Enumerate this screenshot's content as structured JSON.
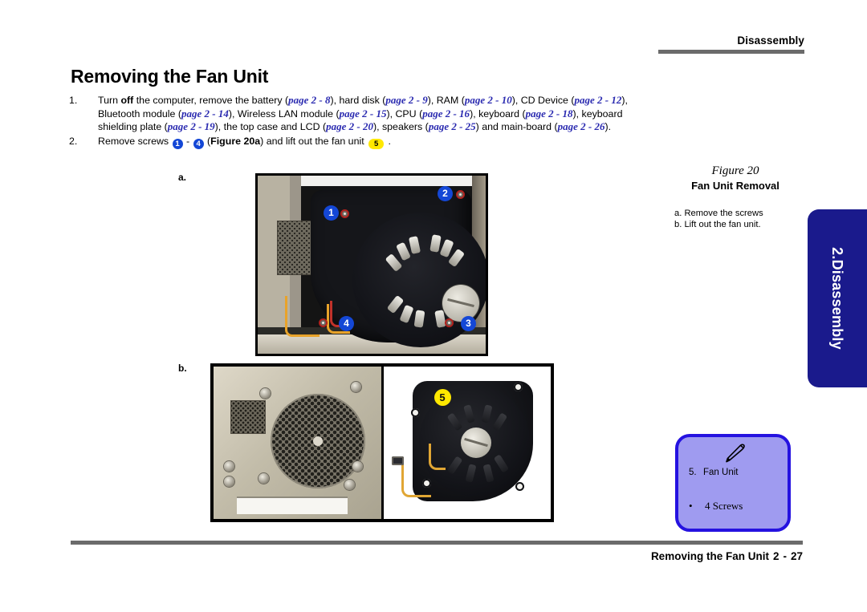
{
  "header": {
    "section": "Disassembly"
  },
  "title": "Removing the Fan Unit",
  "steps": [
    {
      "number": "1.",
      "segments": [
        {
          "t": "Turn ",
          "s": "plain"
        },
        {
          "t": "off",
          "s": "bold"
        },
        {
          "t": " the computer, remove the battery (",
          "s": "plain"
        },
        {
          "t": "page 2 - 8",
          "s": "ref"
        },
        {
          "t": "), hard disk (",
          "s": "plain"
        },
        {
          "t": "page 2 - 9",
          "s": "ref"
        },
        {
          "t": "),  RAM (",
          "s": "plain"
        },
        {
          "t": "page 2 - 10",
          "s": "ref"
        },
        {
          "t": "), CD Device (",
          "s": "plain"
        },
        {
          "t": "page 2 - 12",
          "s": "ref"
        },
        {
          "t": "), Bluetooth module (",
          "s": "plain"
        },
        {
          "t": "page 2 - 14",
          "s": "ref"
        },
        {
          "t": "), Wireless LAN module (",
          "s": "plain"
        },
        {
          "t": "page 2 - 15",
          "s": "ref"
        },
        {
          "t": "), CPU (",
          "s": "plain"
        },
        {
          "t": "page 2 - 16",
          "s": "ref"
        },
        {
          "t": "), keyboard (",
          "s": "plain"
        },
        {
          "t": "page 2 - 18",
          "s": "ref"
        },
        {
          "t": "), keyboard shielding plate (",
          "s": "plain"
        },
        {
          "t": "page 2 - 19",
          "s": "ref"
        },
        {
          "t": "),  the top case and LCD (",
          "s": "plain"
        },
        {
          "t": "page 2 - 20",
          "s": "ref"
        },
        {
          "t": "), speakers (",
          "s": "plain"
        },
        {
          "t": "page 2 - 25",
          "s": "ref"
        },
        {
          "t": ") and main-board (",
          "s": "plain"
        },
        {
          "t": "page 2 - 26",
          "s": "ref"
        },
        {
          "t": ").",
          "s": "plain"
        }
      ]
    },
    {
      "number": "2.",
      "segments": [
        {
          "t": "Remove screws ",
          "s": "plain"
        },
        {
          "t": "1",
          "s": "badge"
        },
        {
          "t": " - ",
          "s": "plain"
        },
        {
          "t": "4",
          "s": "badge"
        },
        {
          "t": " (",
          "s": "plain"
        },
        {
          "t": "Figure 20a",
          "s": "bold"
        },
        {
          "t": ") and lift out the fan unit ",
          "s": "plain"
        },
        {
          "t": "5",
          "s": "badge-yellow"
        },
        {
          "t": " .",
          "s": "plain"
        }
      ]
    }
  ],
  "figures": {
    "label_a": "a.",
    "label_b": "b.",
    "figure_a_callouts": [
      "1",
      "2",
      "3",
      "4"
    ],
    "figure_b_callout": "5"
  },
  "sidebar": {
    "figure_number": "Figure 20",
    "figure_title": "Fan Unit Removal",
    "notes": [
      "a. Remove the screws",
      "b. Lift out the fan unit."
    ],
    "chapter_tab": "2.Disassembly",
    "note_box": {
      "icon": "pen-icon",
      "item_number": "5.",
      "item_label": "Fan Unit",
      "bullet": "•",
      "bullet_label": "4 Screws"
    }
  },
  "footer": {
    "title": "Removing the Fan Unit",
    "chapter": "2",
    "dash": "-",
    "page": "27"
  },
  "colors": {
    "callout_blue": "#1447d6",
    "callout_yellow": "#ffe800",
    "reference_link": "#2a2ab0",
    "tab_navy": "#1a1a8c",
    "note_fill": "#9f9bf0",
    "note_border": "#2512e0",
    "rule_gray": "#6b6b6b"
  }
}
